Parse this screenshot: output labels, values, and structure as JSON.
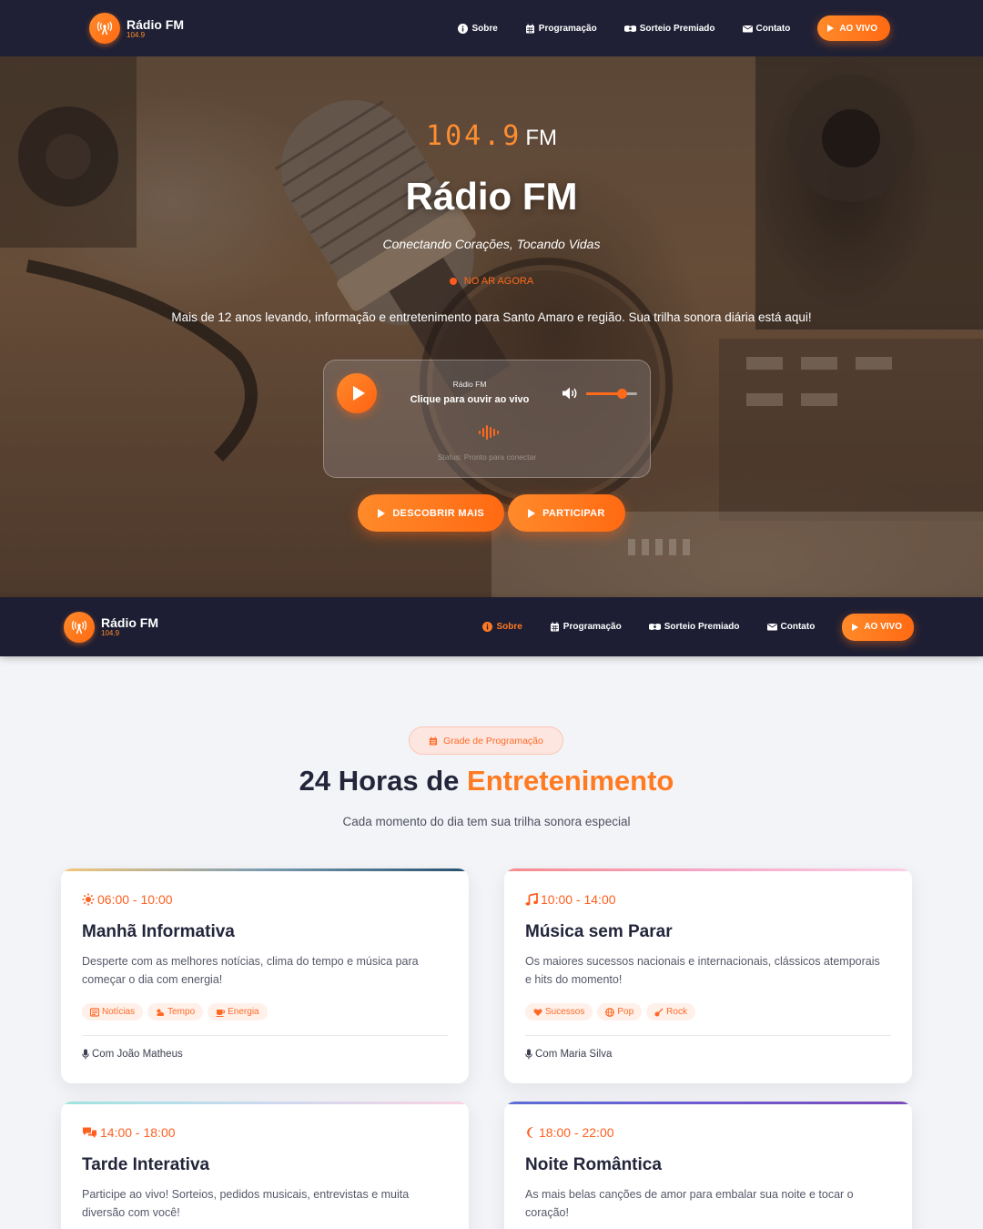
{
  "nav": {
    "brand_name": "Rádio FM",
    "brand_freq": "104.9",
    "items": [
      {
        "label": "Sobre",
        "icon": "info-circle-icon"
      },
      {
        "label": "Programação",
        "icon": "calendar-icon"
      },
      {
        "label": "Sorteio Premiado",
        "icon": "ticket-icon"
      },
      {
        "label": "Contato",
        "icon": "envelope-icon"
      }
    ],
    "live_label": "AO VIVO",
    "sticky_active_item": "Sobre"
  },
  "hero": {
    "frequency": "104.9",
    "frequency_unit": "FM",
    "title": "Rádio FM",
    "slogan": "Conectando Corações, Tocando Vidas",
    "on_air": "NO AR AGORA",
    "description": "Mais de 12 anos levando, informação e entretenimento para Santo Amaro e região. Sua trilha sonora diária está aqui!",
    "player": {
      "station": "Rádio FM",
      "cta": "Clique para ouvir ao vivo",
      "status": "Status: Pronto para conectar",
      "volume": 0.7
    },
    "buttons": [
      "DESCOBRIR MAIS",
      "PARTICIPAR"
    ]
  },
  "schedule": {
    "badge": "Grade de Programação",
    "title_main": "24 Horas de",
    "title_highlight": "Entretenimento",
    "subtitle": "Cada momento do dia tem sua trilha sonora especial",
    "cards": [
      {
        "time": "06:00 - 10:00",
        "icon": "sun-icon",
        "title": "Manhã Informativa",
        "description": "Desperte com as melhores notícias, clima do tempo e música para começar o dia com energia!",
        "tags": [
          {
            "label": "Notícias",
            "icon": "newspaper-icon"
          },
          {
            "label": "Tempo",
            "icon": "cloud-sun-icon"
          },
          {
            "label": "Energia",
            "icon": "coffee-icon"
          }
        ],
        "host": "Com João Matheus"
      },
      {
        "time": "10:00 - 14:00",
        "icon": "music-note-icon",
        "title": "Música sem Parar",
        "description": "Os maiores sucessos nacionais e internacionais, clássicos atemporais e hits do momento!",
        "tags": [
          {
            "label": "Sucessos",
            "icon": "heart-icon"
          },
          {
            "label": "Pop",
            "icon": "globe-icon"
          },
          {
            "label": "Rock",
            "icon": "guitar-icon"
          }
        ],
        "host": "Com Maria Silva"
      },
      {
        "time": "14:00 - 18:00",
        "icon": "comments-icon",
        "title": "Tarde Interativa",
        "description": "Participe ao vivo! Sorteios, pedidos musicais, entrevistas e muita diversão com você!"
      },
      {
        "time": "18:00 - 22:00",
        "icon": "moon-icon",
        "title": "Noite Romântica",
        "description": "As mais belas canções de amor para embalar sua noite e tocar o coração!"
      }
    ]
  }
}
